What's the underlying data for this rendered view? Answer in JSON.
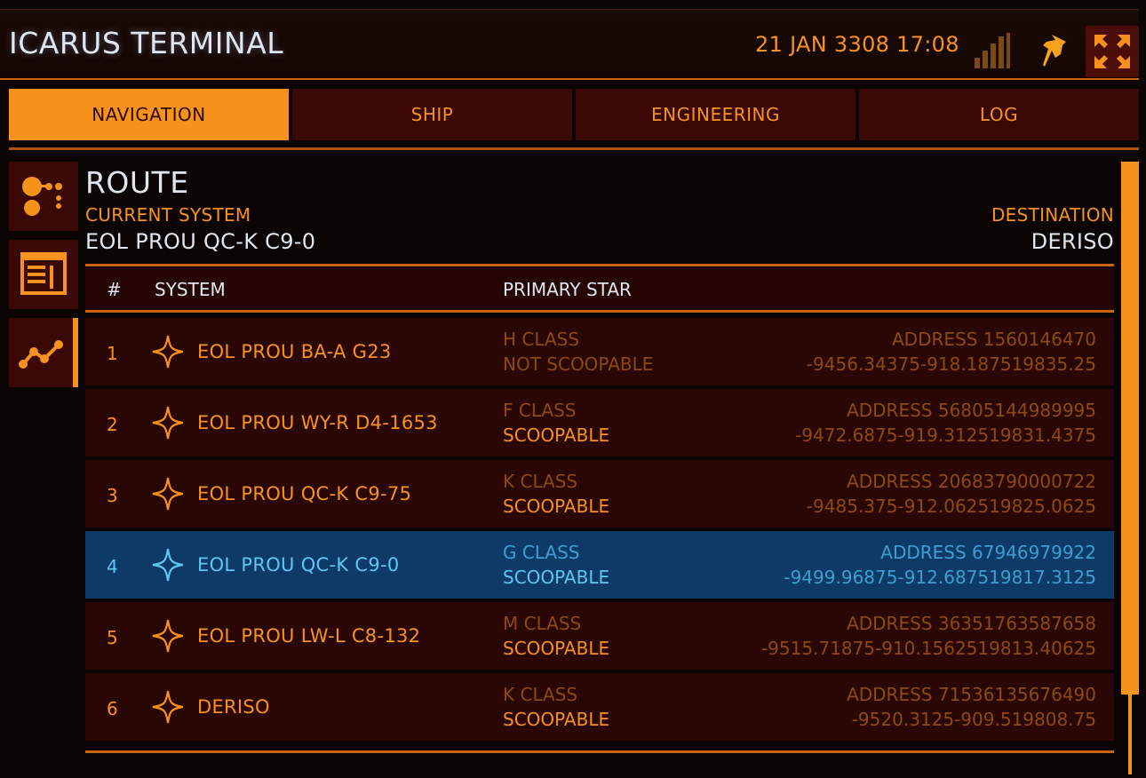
{
  "app": {
    "title": "ICARUS TERMINAL",
    "datetime": "21 JAN 3308 17:08",
    "signal_icon": "signal-strength-icon",
    "pin_icon": "pin-icon",
    "fullscreen_icon": "fullscreen-icon"
  },
  "tabs": [
    {
      "label": "NAVIGATION",
      "active": true
    },
    {
      "label": "SHIP",
      "active": false
    },
    {
      "label": "ENGINEERING",
      "active": false
    },
    {
      "label": "LOG",
      "active": false
    }
  ],
  "sidebar": [
    {
      "icon": "system-map-icon"
    },
    {
      "icon": "list-view-icon"
    },
    {
      "icon": "route-icon",
      "active": true
    }
  ],
  "route": {
    "title": "ROUTE",
    "current_label": "CURRENT SYSTEM",
    "current_value": "EOL PROU QC-K C9-0",
    "destination_label": "DESTINATION",
    "destination_value": "DERISO"
  },
  "table": {
    "headers": {
      "num": "#",
      "system": "SYSTEM",
      "star": "PRIMARY STAR"
    },
    "rows": [
      {
        "num": "1",
        "name": "EOL PROU BA-A G23",
        "class": "H CLASS",
        "scoop": "NOT SCOOPABLE",
        "address": "ADDRESS 1560146470",
        "coords": "-9456.34375-918.187519835.25"
      },
      {
        "num": "2",
        "name": "EOL PROU WY-R D4-1653",
        "class": "F CLASS",
        "scoop": "SCOOPABLE",
        "address": "ADDRESS 56805144989995",
        "coords": "-9472.6875-919.312519831.4375"
      },
      {
        "num": "3",
        "name": "EOL PROU QC-K C9-75",
        "class": "K CLASS",
        "scoop": "SCOOPABLE",
        "address": "ADDRESS 20683790000722",
        "coords": "-9485.375-912.062519825.0625"
      },
      {
        "num": "4",
        "name": "EOL PROU QC-K C9-0",
        "class": "G CLASS",
        "scoop": "SCOOPABLE",
        "address": "ADDRESS 67946979922",
        "coords": "-9499.96875-912.687519817.3125",
        "selected": true
      },
      {
        "num": "5",
        "name": "EOL PROU LW-L C8-132",
        "class": "M CLASS",
        "scoop": "SCOOPABLE",
        "address": "ADDRESS 36351763587658",
        "coords": "-9515.71875-910.1562519813.40625"
      },
      {
        "num": "6",
        "name": "DERISO",
        "class": "K CLASS",
        "scoop": "SCOOPABLE",
        "address": "ADDRESS 71536135676490",
        "coords": "-9520.3125-909.519808.75"
      }
    ]
  },
  "colors": {
    "accent": "#f7921c",
    "dim": "#8c4a0e",
    "panel": "#2a0705",
    "selected": "#0d3a66",
    "selected_text": "#5cc8f0",
    "heading_text": "#dfe6f0"
  }
}
